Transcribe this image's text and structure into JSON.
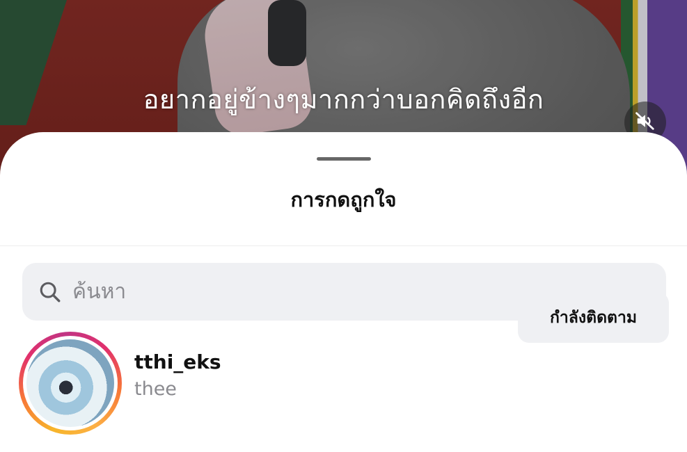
{
  "video": {
    "caption": "อยากอยู่ข้างๆมากกว่าบอกคิดถึงอีก",
    "mute_icon": "speaker-muted-icon"
  },
  "sheet": {
    "title": "การกดถูกใจ",
    "search": {
      "placeholder": "ค้นหา",
      "icon": "search-icon"
    },
    "likers": [
      {
        "username": "tthi_eks",
        "full_name": "thee",
        "follow_label": "กำลังติดตาม",
        "has_story_ring": true
      }
    ]
  },
  "colors": {
    "sheet_background": "#ffffff",
    "search_background": "#eff0f3",
    "secondary_text": "#8a8a8f",
    "button_background": "#eff0f3"
  }
}
